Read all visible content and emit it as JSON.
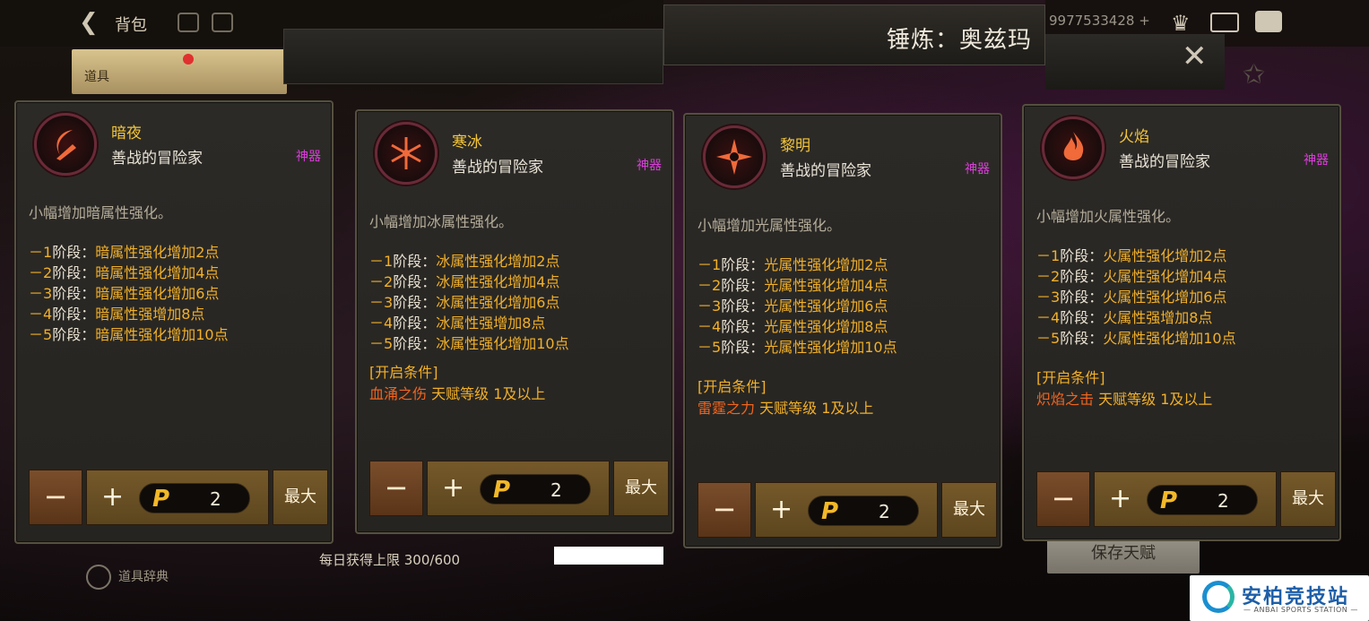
{
  "topbar": {
    "back_label": "背包",
    "player_id": "9977533428 +",
    "item_tab": "道具",
    "header_title": "锤炼：奥兹玛"
  },
  "footer": {
    "daily_limit": "每日获得上限 300/600",
    "save_talent": "保存天赋",
    "item_dict": "道具辞典"
  },
  "cards": [
    {
      "name": "暗夜",
      "subtitle": "善战的冒险家",
      "tag": "神器",
      "desc": "小幅增加暗属性强化。",
      "element_color": "#f06a3a",
      "stages": [
        {
          "dash": "－",
          "num": "1",
          "label": "阶段：",
          "effect": "暗属性强化增加2点"
        },
        {
          "dash": "－",
          "num": "2",
          "label": "阶段：",
          "effect": "暗属性强化增加4点"
        },
        {
          "dash": "－",
          "num": "3",
          "label": "阶段：",
          "effect": "暗属性强化增加6点"
        },
        {
          "dash": "－",
          "num": "4",
          "label": "阶段：",
          "effect": "暗属性强增加8点"
        },
        {
          "dash": "－",
          "num": "5",
          "label": "阶段：",
          "effect": "暗属性强化增加10点"
        }
      ],
      "condition_title": "",
      "condition_skill": "",
      "condition_text": "",
      "points": "2",
      "minus": "−",
      "plus": "+",
      "max": "最大"
    },
    {
      "name": "寒冰",
      "subtitle": "善战的冒险家",
      "tag": "神器",
      "desc": "小幅增加冰属性强化。",
      "element_color": "#f06a3a",
      "stages": [
        {
          "dash": "－",
          "num": "1",
          "label": "阶段：",
          "effect": "冰属性强化增加2点"
        },
        {
          "dash": "－",
          "num": "2",
          "label": "阶段：",
          "effect": "冰属性强化增加4点"
        },
        {
          "dash": "－",
          "num": "3",
          "label": "阶段：",
          "effect": "冰属性强化增加6点"
        },
        {
          "dash": "－",
          "num": "4",
          "label": "阶段：",
          "effect": "冰属性强增加8点"
        },
        {
          "dash": "－",
          "num": "5",
          "label": "阶段：",
          "effect": "冰属性强化增加10点"
        }
      ],
      "condition_title": "[开启条件]",
      "condition_skill": "血涌之伤",
      "condition_text": " 天赋等级 1及以上",
      "points": "2",
      "minus": "−",
      "plus": "+",
      "max": "最大"
    },
    {
      "name": "黎明",
      "subtitle": "善战的冒险家",
      "tag": "神器",
      "desc": "小幅增加光属性强化。",
      "element_color": "#f06a3a",
      "stages": [
        {
          "dash": "－",
          "num": "1",
          "label": "阶段：",
          "effect": "光属性强化增加2点"
        },
        {
          "dash": "－",
          "num": "2",
          "label": "阶段：",
          "effect": "光属性强化增加4点"
        },
        {
          "dash": "－",
          "num": "3",
          "label": "阶段：",
          "effect": "光属性强化增加6点"
        },
        {
          "dash": "－",
          "num": "4",
          "label": "阶段：",
          "effect": "光属性强化增加8点"
        },
        {
          "dash": "－",
          "num": "5",
          "label": "阶段：",
          "effect": "光属性强化增加10点"
        }
      ],
      "condition_title": "[开启条件]",
      "condition_skill": "雷霆之力",
      "condition_text": " 天赋等级 1及以上",
      "points": "2",
      "minus": "−",
      "plus": "+",
      "max": "最大"
    },
    {
      "name": "火焰",
      "subtitle": "善战的冒险家",
      "tag": "神器",
      "desc": "小幅增加火属性强化。",
      "element_color": "#f06a3a",
      "stages": [
        {
          "dash": "－",
          "num": "1",
          "label": "阶段：",
          "effect": "火属性强化增加2点"
        },
        {
          "dash": "－",
          "num": "2",
          "label": "阶段：",
          "effect": "火属性强化增加4点"
        },
        {
          "dash": "－",
          "num": "3",
          "label": "阶段：",
          "effect": "火属性强化增加6点"
        },
        {
          "dash": "－",
          "num": "4",
          "label": "阶段：",
          "effect": "火属性强增加8点"
        },
        {
          "dash": "－",
          "num": "5",
          "label": "阶段：",
          "effect": "火属性强化增加10点"
        }
      ],
      "condition_title": "[开启条件]",
      "condition_skill": "炽焰之击",
      "condition_text": " 天赋等级 1及以上",
      "points": "2",
      "minus": "−",
      "plus": "+",
      "max": "最大"
    }
  ],
  "watermark": {
    "title": "安柏竞技站",
    "subtitle": "— ANBAI SPORTS STATION —"
  }
}
